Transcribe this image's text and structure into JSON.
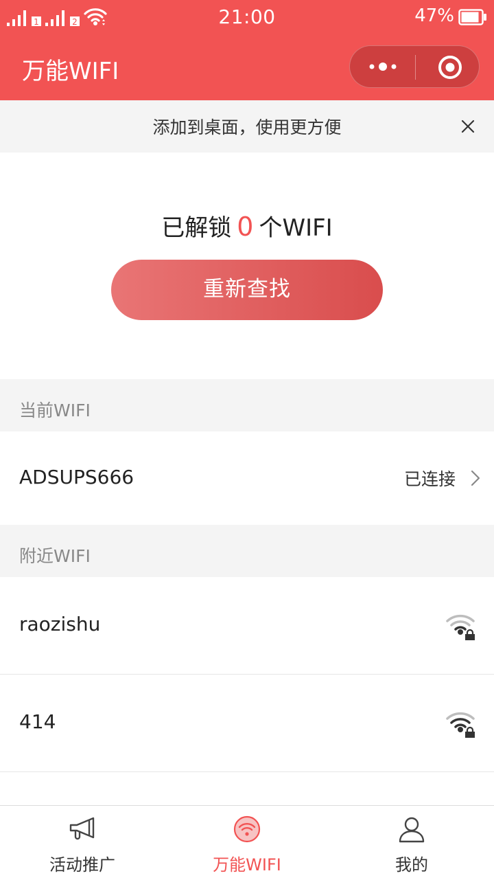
{
  "status_bar": {
    "time": "21:00",
    "battery_percent": "47%",
    "battery_level": 0.47,
    "sim1_badge": "1",
    "sim2_badge": "2"
  },
  "navbar": {
    "title": "万能WIFI"
  },
  "banner": {
    "text": "添加到桌面，使用更方便"
  },
  "hero": {
    "prefix": "已解锁",
    "count": "0",
    "suffix": "个WIFI",
    "refind_button": "重新查找"
  },
  "current_section": {
    "header": "当前WIFI",
    "network": {
      "ssid": "ADSUPS666",
      "status": "已连接"
    }
  },
  "nearby_section": {
    "header": "附近WIFI",
    "networks": [
      {
        "ssid": "raozishu",
        "icon": "locked-wifi-icon"
      },
      {
        "ssid": "414",
        "icon": "locked-wifi-icon"
      }
    ]
  },
  "tabbar": {
    "tabs": [
      {
        "label": "活动推广",
        "icon": "megaphone-icon",
        "active": false
      },
      {
        "label": "万能WIFI",
        "icon": "wifi-icon",
        "active": true
      },
      {
        "label": "我的",
        "icon": "user-icon",
        "active": false
      }
    ]
  },
  "colors": {
    "brand_red": "#f25353",
    "gray_background": "#f4f4f4"
  }
}
